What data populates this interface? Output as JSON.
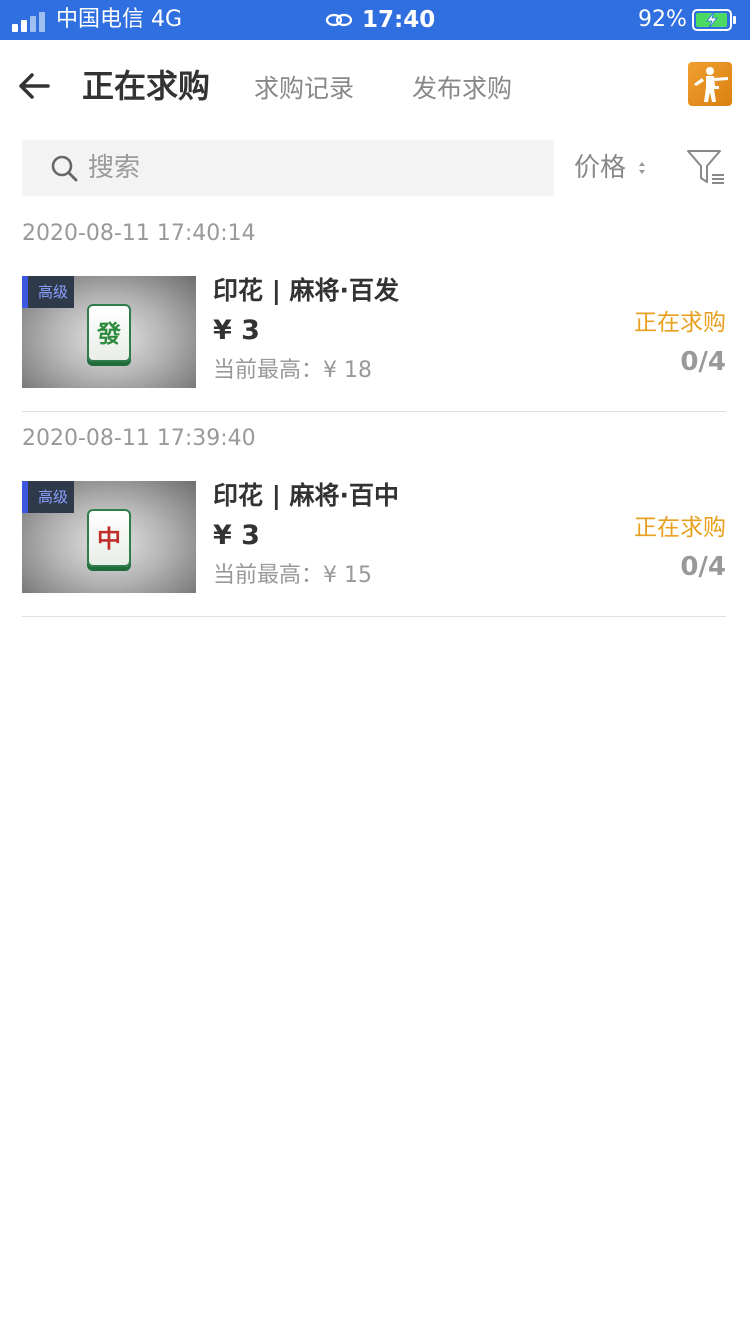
{
  "status_bar": {
    "carrier": "中国电信  4G",
    "time": "17:40",
    "battery": "92%"
  },
  "header": {
    "tabs": [
      {
        "label": "正在求购",
        "active": true
      },
      {
        "label": "求购记录",
        "active": false
      },
      {
        "label": "发布求购",
        "active": false
      }
    ],
    "back_icon": "arrow-left-icon",
    "logo_icon": "game-logo-icon"
  },
  "search": {
    "placeholder": "搜索"
  },
  "sort": {
    "label": "价格"
  },
  "entries": [
    {
      "time": "2020-08-11 17:40:14",
      "grade": "高级",
      "tile_char": "發",
      "tile_color": "#2e8b3e",
      "name": "印花 | 麻将·百发",
      "price": "¥ 3",
      "highest": "当前最高：¥ 18",
      "status": "正在求购",
      "count": "0/4"
    },
    {
      "time": "2020-08-11 17:39:40",
      "grade": "高级",
      "tile_char": "中",
      "tile_color": "#c0302a",
      "name": "印花 | 麻将·百中",
      "price": "¥ 3",
      "highest": "当前最高：¥ 15",
      "status": "正在求购",
      "count": "0/4"
    }
  ],
  "colors": {
    "status_bar": "#2f6fe0",
    "accent_status": "#e8a020",
    "grade_badge": "#3c56e0"
  }
}
